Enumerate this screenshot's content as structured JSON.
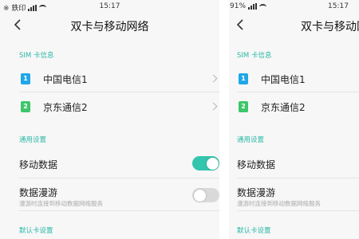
{
  "left": {
    "status": {
      "carrier": "※ 鉄印",
      "time": "15:17"
    },
    "nav": {
      "title": "双卡与移动网络"
    },
    "sim_section": {
      "header": "SIM 卡信息",
      "items": [
        {
          "label": "中国电信1",
          "icon": "sim-card-icon",
          "icon_text": "1",
          "color": "#1fa7e8"
        },
        {
          "label": "京东通信2",
          "icon": "sim-card-icon",
          "icon_text": "2",
          "color": "#3ec66a"
        }
      ]
    },
    "general_section": {
      "header": "通用设置",
      "mobile_data": {
        "label": "移动数据",
        "enabled": true
      },
      "roaming": {
        "label": "数据漫游",
        "subtitle": "漫游时连接到移动数据网络服务",
        "enabled": false
      }
    },
    "default_section": {
      "header": "默认卡设置"
    }
  },
  "right": {
    "status": {
      "battery": "91%",
      "time": "15:17"
    },
    "nav": {
      "title": "双卡与移动网络"
    },
    "sim_section": {
      "header": "SIM 卡信息",
      "items": [
        {
          "label": "中国电信1",
          "icon_text": "1"
        },
        {
          "label": "京东通信2",
          "icon_text": "2"
        }
      ]
    },
    "general_section": {
      "header": "通用设置",
      "mobile_data": {
        "label": "移动数据"
      },
      "roaming": {
        "label": "数据漫游",
        "subtitle": "漫游时连接到移动数据网络服务"
      }
    },
    "default_section": {
      "header": "默认卡设置"
    }
  },
  "colors": {
    "accent": "#2ab8a6",
    "toggle_on": "#33c5ad",
    "sim1": "#1fa7e8",
    "sim2": "#3ec66a"
  }
}
